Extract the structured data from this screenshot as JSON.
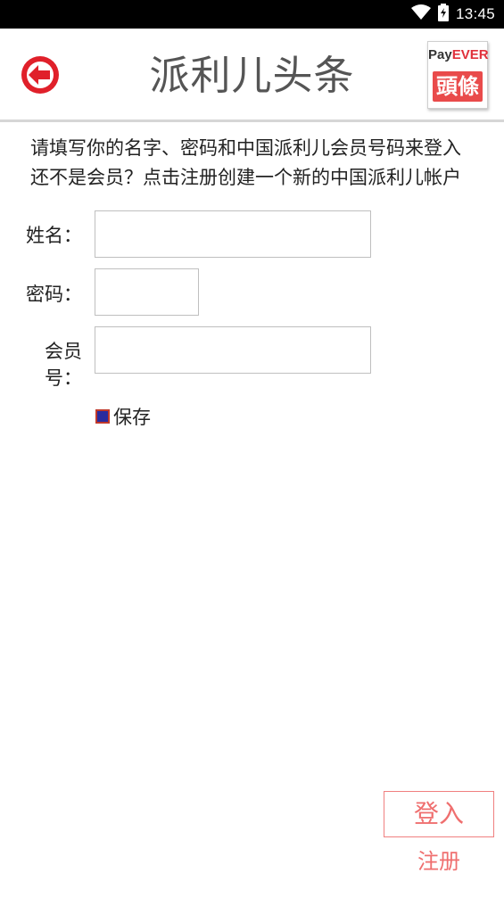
{
  "status_bar": {
    "time": "13:45",
    "wifi_icon": "wifi-icon",
    "battery_icon": "battery-charging-icon"
  },
  "header": {
    "title": "派利儿头条",
    "back_icon": "back-arrow-icon",
    "logo": {
      "pay": "Pay",
      "ever": "EVER",
      "bottom": "頭條"
    }
  },
  "instructions": {
    "line1": "请填写你的名字、密码和中国派利儿会员号码来登入",
    "line2": "还不是会员？点击注册创建一个新的中国派利儿帐户"
  },
  "form": {
    "name_label": "姓名：",
    "name_value": "",
    "password_label": "密码：",
    "password_value": "",
    "member_label": "会员号：",
    "member_value": "",
    "save_label": "保存",
    "save_checked": true
  },
  "actions": {
    "login_label": "登入",
    "register_label": "注册"
  },
  "colors": {
    "accent": "#ef6f6f",
    "back_button": "#e0202a",
    "logo_red": "#e94b4b"
  }
}
